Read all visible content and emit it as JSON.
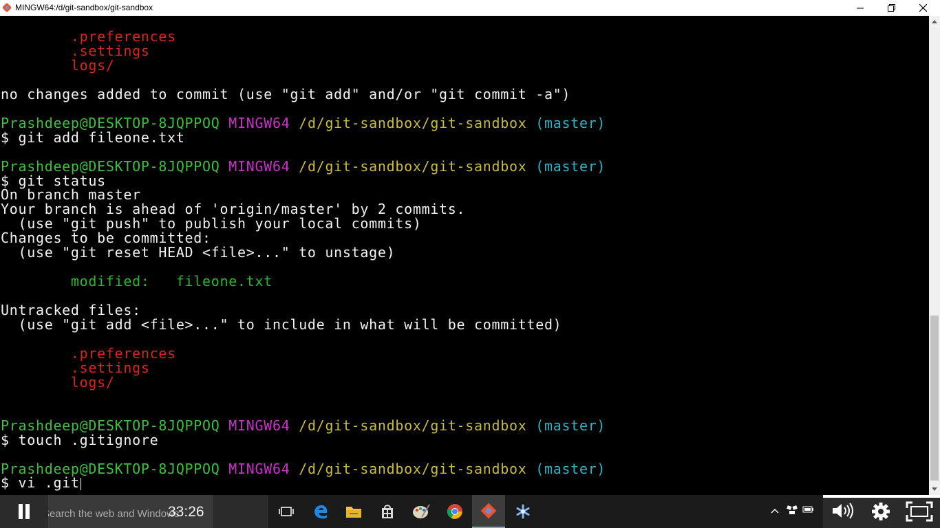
{
  "window": {
    "title": "MINGW64:/d/git-sandbox/git-sandbox"
  },
  "terminal": {
    "lines": [
      [
        {
          "t": "        .preferences",
          "c": "red"
        }
      ],
      [
        {
          "t": "        .settings",
          "c": "red"
        }
      ],
      [
        {
          "t": "        logs/",
          "c": "red"
        }
      ],
      [],
      [
        {
          "t": "no changes added to commit (use \"git add\" and/or \"git commit -a\")",
          "c": "white"
        }
      ],
      [],
      [
        {
          "t": "Prashdeep@DESKTOP-8JQPPOQ",
          "c": "green"
        },
        {
          "t": " ",
          "c": "white"
        },
        {
          "t": "MINGW64",
          "c": "magenta"
        },
        {
          "t": " ",
          "c": "white"
        },
        {
          "t": "/d/git-sandbox/git-sandbox",
          "c": "yellow"
        },
        {
          "t": " ",
          "c": "white"
        },
        {
          "t": "(master)",
          "c": "cyan"
        }
      ],
      [
        {
          "t": "$ git add fileone.txt",
          "c": "white"
        }
      ],
      [],
      [
        {
          "t": "Prashdeep@DESKTOP-8JQPPOQ",
          "c": "green"
        },
        {
          "t": " ",
          "c": "white"
        },
        {
          "t": "MINGW64",
          "c": "magenta"
        },
        {
          "t": " ",
          "c": "white"
        },
        {
          "t": "/d/git-sandbox/git-sandbox",
          "c": "yellow"
        },
        {
          "t": " ",
          "c": "white"
        },
        {
          "t": "(master)",
          "c": "cyan"
        }
      ],
      [
        {
          "t": "$ git status",
          "c": "white"
        }
      ],
      [
        {
          "t": "On branch master",
          "c": "white"
        }
      ],
      [
        {
          "t": "Your branch is ahead of 'origin/master' by 2 commits.",
          "c": "white"
        }
      ],
      [
        {
          "t": "  (use \"git push\" to publish your local commits)",
          "c": "white"
        }
      ],
      [
        {
          "t": "Changes to be committed:",
          "c": "white"
        }
      ],
      [
        {
          "t": "  (use \"git reset HEAD <file>...\" to unstage)",
          "c": "white"
        }
      ],
      [],
      [
        {
          "t": "        modified:   fileone.txt",
          "c": "green-dim"
        }
      ],
      [],
      [
        {
          "t": "Untracked files:",
          "c": "white"
        }
      ],
      [
        {
          "t": "  (use \"git add <file>...\" to include in what will be committed)",
          "c": "white"
        }
      ],
      [],
      [
        {
          "t": "        .preferences",
          "c": "red"
        }
      ],
      [
        {
          "t": "        .settings",
          "c": "red"
        }
      ],
      [
        {
          "t": "        logs/",
          "c": "red"
        }
      ],
      [],
      [],
      [
        {
          "t": "Prashdeep@DESKTOP-8JQPPOQ",
          "c": "green"
        },
        {
          "t": " ",
          "c": "white"
        },
        {
          "t": "MINGW64",
          "c": "magenta"
        },
        {
          "t": " ",
          "c": "white"
        },
        {
          "t": "/d/git-sandbox/git-sandbox",
          "c": "yellow"
        },
        {
          "t": " ",
          "c": "white"
        },
        {
          "t": "(master)",
          "c": "cyan"
        }
      ],
      [
        {
          "t": "$ touch .gitignore",
          "c": "white"
        }
      ],
      [],
      [
        {
          "t": "Prashdeep@DESKTOP-8JQPPOQ",
          "c": "green"
        },
        {
          "t": " ",
          "c": "white"
        },
        {
          "t": "MINGW64",
          "c": "magenta"
        },
        {
          "t": " ",
          "c": "white"
        },
        {
          "t": "/d/git-sandbox/git-sandbox",
          "c": "yellow"
        },
        {
          "t": " ",
          "c": "white"
        },
        {
          "t": "(master)",
          "c": "cyan"
        }
      ],
      [
        {
          "t": "$ vi .git",
          "c": "white"
        }
      ]
    ]
  },
  "taskbar": {
    "search_placeholder": "Search the web and Windows",
    "timer": "33:26",
    "apps": [
      "task-view-icon",
      "edge-icon",
      "file-explorer-icon",
      "store-icon",
      "paint-icon",
      "chrome-icon",
      "git-bash-icon",
      "snowflake-app-icon"
    ],
    "active_app": "git-bash-icon"
  },
  "colors": {
    "red": "#d9261c",
    "green": "#3fbf3f",
    "magenta": "#c931c9",
    "yellow": "#c8bc3a",
    "cyan": "#2bb5c8"
  }
}
